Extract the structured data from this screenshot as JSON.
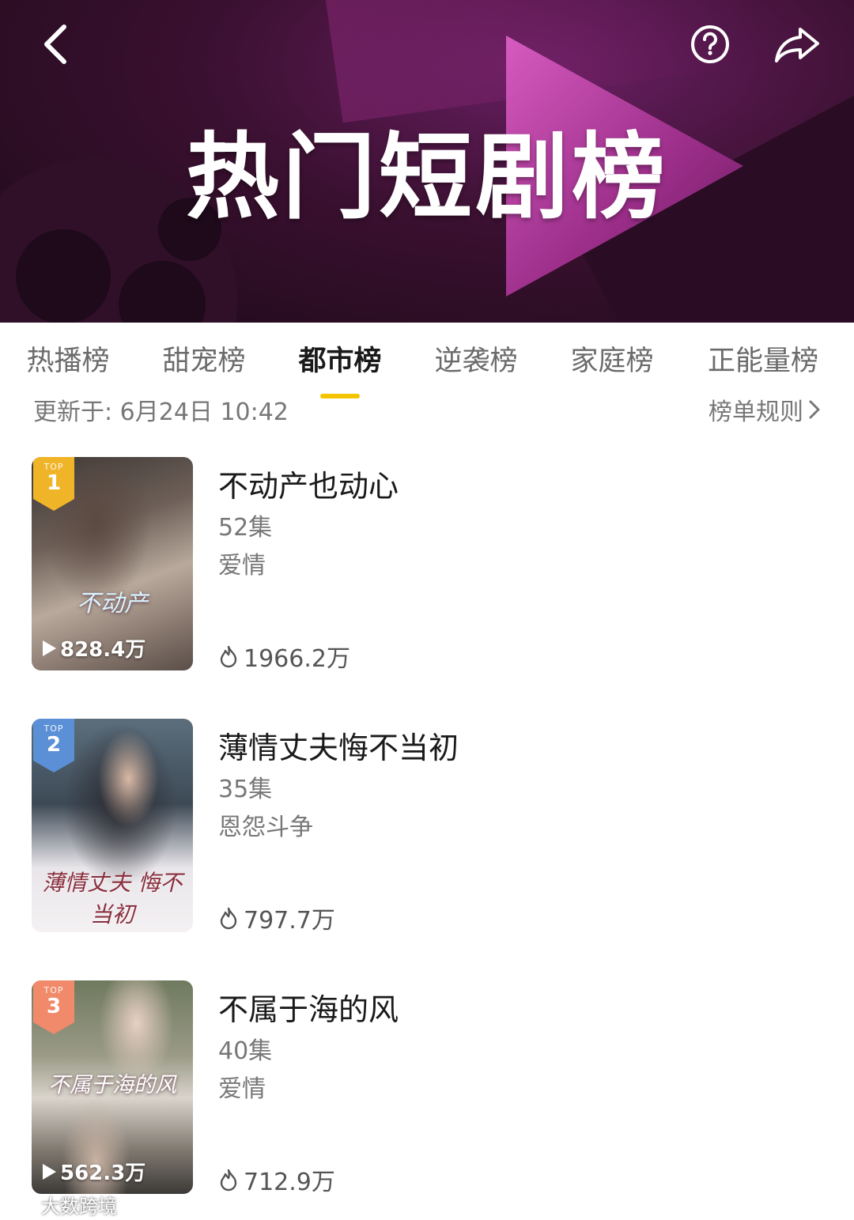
{
  "header": {
    "title": "热门短剧榜",
    "back_icon": "chevron-left-icon",
    "help_icon": "question-circle-icon",
    "share_icon": "share-arrow-icon"
  },
  "tabs": [
    {
      "label": "热播榜",
      "active": false
    },
    {
      "label": "甜宠榜",
      "active": false
    },
    {
      "label": "都市榜",
      "active": true
    },
    {
      "label": "逆袭榜",
      "active": false
    },
    {
      "label": "家庭榜",
      "active": false
    },
    {
      "label": "正能量榜",
      "active": false
    }
  ],
  "update": {
    "text": "更新于: 6月24日 10:42",
    "rules_label": "榜单规则"
  },
  "items": [
    {
      "rank": "1",
      "badge_top": "TOP",
      "title": "不动产也动心",
      "episodes": "52集",
      "genre": "爱情",
      "heat": "1966.2万",
      "cover_play_count": "828.4万",
      "cover_title": "不动产"
    },
    {
      "rank": "2",
      "badge_top": "TOP",
      "title": "薄情丈夫悔不当初",
      "episodes": "35集",
      "genre": "恩怨斗争",
      "heat": "797.7万",
      "cover_title": "薄情丈夫 悔不当初"
    },
    {
      "rank": "3",
      "badge_top": "TOP",
      "title": "不属于海的风",
      "episodes": "40集",
      "genre": "爱情",
      "heat": "712.9万",
      "cover_play_count": "562.3万",
      "cover_title": "不属于海的风"
    }
  ],
  "watermark": "大数跨境",
  "colors": {
    "accent_underline": "#f5c400",
    "badge_gold": "#f0b429",
    "badge_blue": "#5b8fd6",
    "badge_coral": "#f08a6a"
  }
}
